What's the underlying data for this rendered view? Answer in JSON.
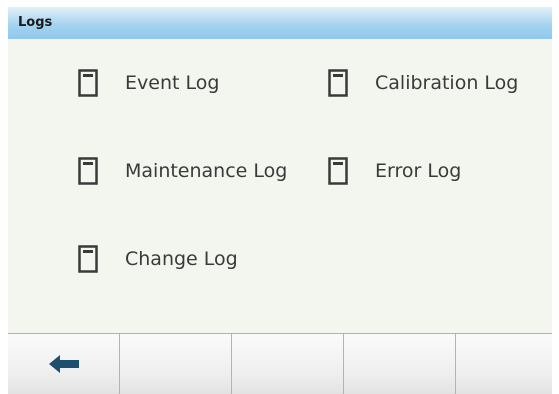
{
  "header": {
    "title": "Logs"
  },
  "menu": {
    "items": [
      {
        "label": "Event Log",
        "icon": "log-document-icon"
      },
      {
        "label": "Calibration Log",
        "icon": "log-document-icon"
      },
      {
        "label": "Maintenance Log",
        "icon": "log-document-icon"
      },
      {
        "label": "Error Log",
        "icon": "log-document-icon"
      },
      {
        "label": "Change Log",
        "icon": "log-document-icon"
      }
    ]
  },
  "softkeys": [
    {
      "icon": "back-arrow-icon",
      "label": ""
    },
    {
      "icon": "",
      "label": ""
    },
    {
      "icon": "",
      "label": ""
    },
    {
      "icon": "",
      "label": ""
    },
    {
      "icon": "",
      "label": ""
    }
  ],
  "colors": {
    "title_bar": "#a5d3ef",
    "content_background": "#f3f6ef",
    "icon_and_text": "#3a3a3a",
    "back_arrow": "#1f4f6e"
  }
}
